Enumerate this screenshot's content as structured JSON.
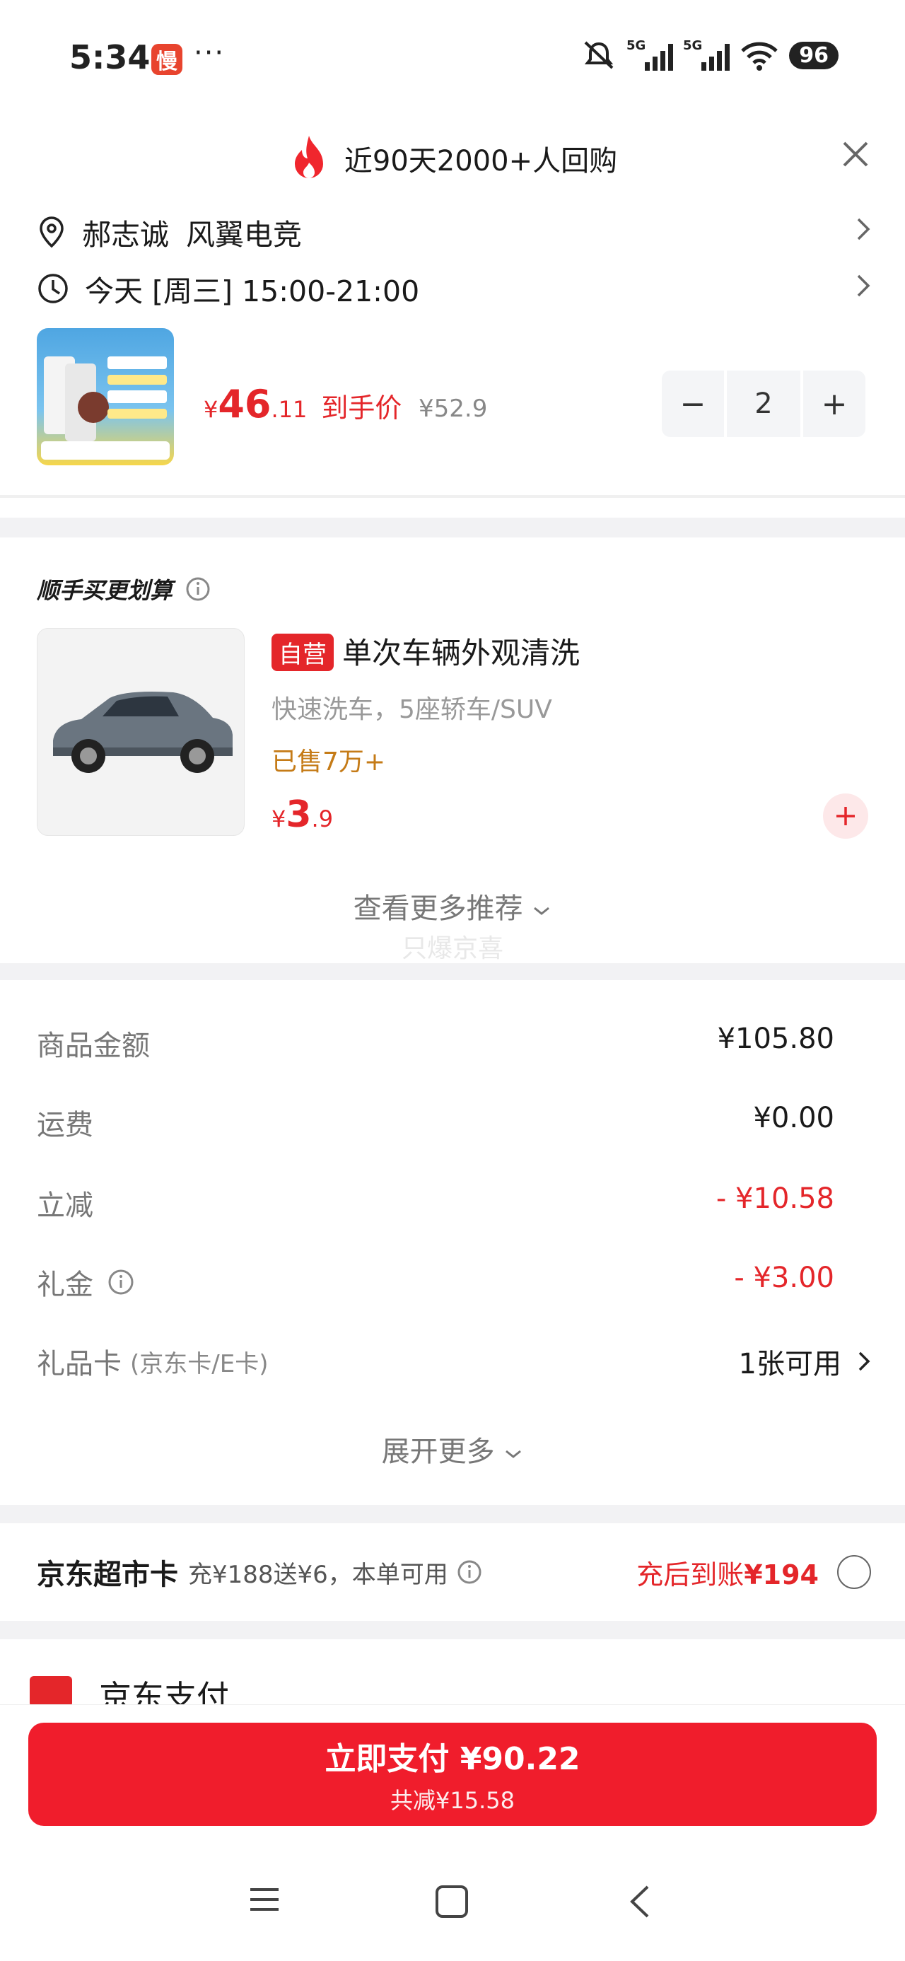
{
  "status_bar": {
    "time": "5:34",
    "app_badge": "慢",
    "dots": "···",
    "battery": "96"
  },
  "header": {
    "title": "近90天2000+人回购"
  },
  "address": {
    "name": "郝志诚",
    "place": "风翼电竞"
  },
  "delivery": {
    "time": "今天 [周三] 15:00-21:00"
  },
  "product": {
    "currency": "¥",
    "price_int": "46",
    "price_dec": ".11",
    "price_label": "到手价",
    "original_price": "¥52.9",
    "qty_minus": "−",
    "qty": "2",
    "qty_plus": "+"
  },
  "bundle": {
    "title": "顺手买更划算",
    "item": {
      "tag": "自营",
      "name": "单次车辆外观清洗",
      "desc": "快速洗车，5座轿车/SUV",
      "sold": "已售7万+",
      "currency": "¥",
      "price_int": "3",
      "price_dec": ".9"
    },
    "more": "查看更多推荐",
    "faint_text": "只爆京喜"
  },
  "summary": {
    "rows": [
      {
        "label": "商品金额",
        "value": "¥105.80"
      },
      {
        "label": "运费",
        "value": "¥0.00"
      },
      {
        "label": "立减",
        "value": "- ¥10.58"
      },
      {
        "label": "礼金",
        "value": "- ¥3.00"
      },
      {
        "label": "礼品卡",
        "sub": "(京东卡/E卡)",
        "value": "1张可用"
      }
    ],
    "expand": "展开更多"
  },
  "supermarket_card": {
    "title": "京东超市卡",
    "desc": "充¥188送¥6，本单可用",
    "after": "充后到账",
    "after_amount": "¥194"
  },
  "payment": {
    "method": "京东支付",
    "button_label": "立即支付 ¥90.22",
    "discount": "共减¥15.58"
  },
  "colors": {
    "accent_red": "#e4262a",
    "pay_button": "#f01d2c",
    "sold_orange": "#c57b17"
  }
}
